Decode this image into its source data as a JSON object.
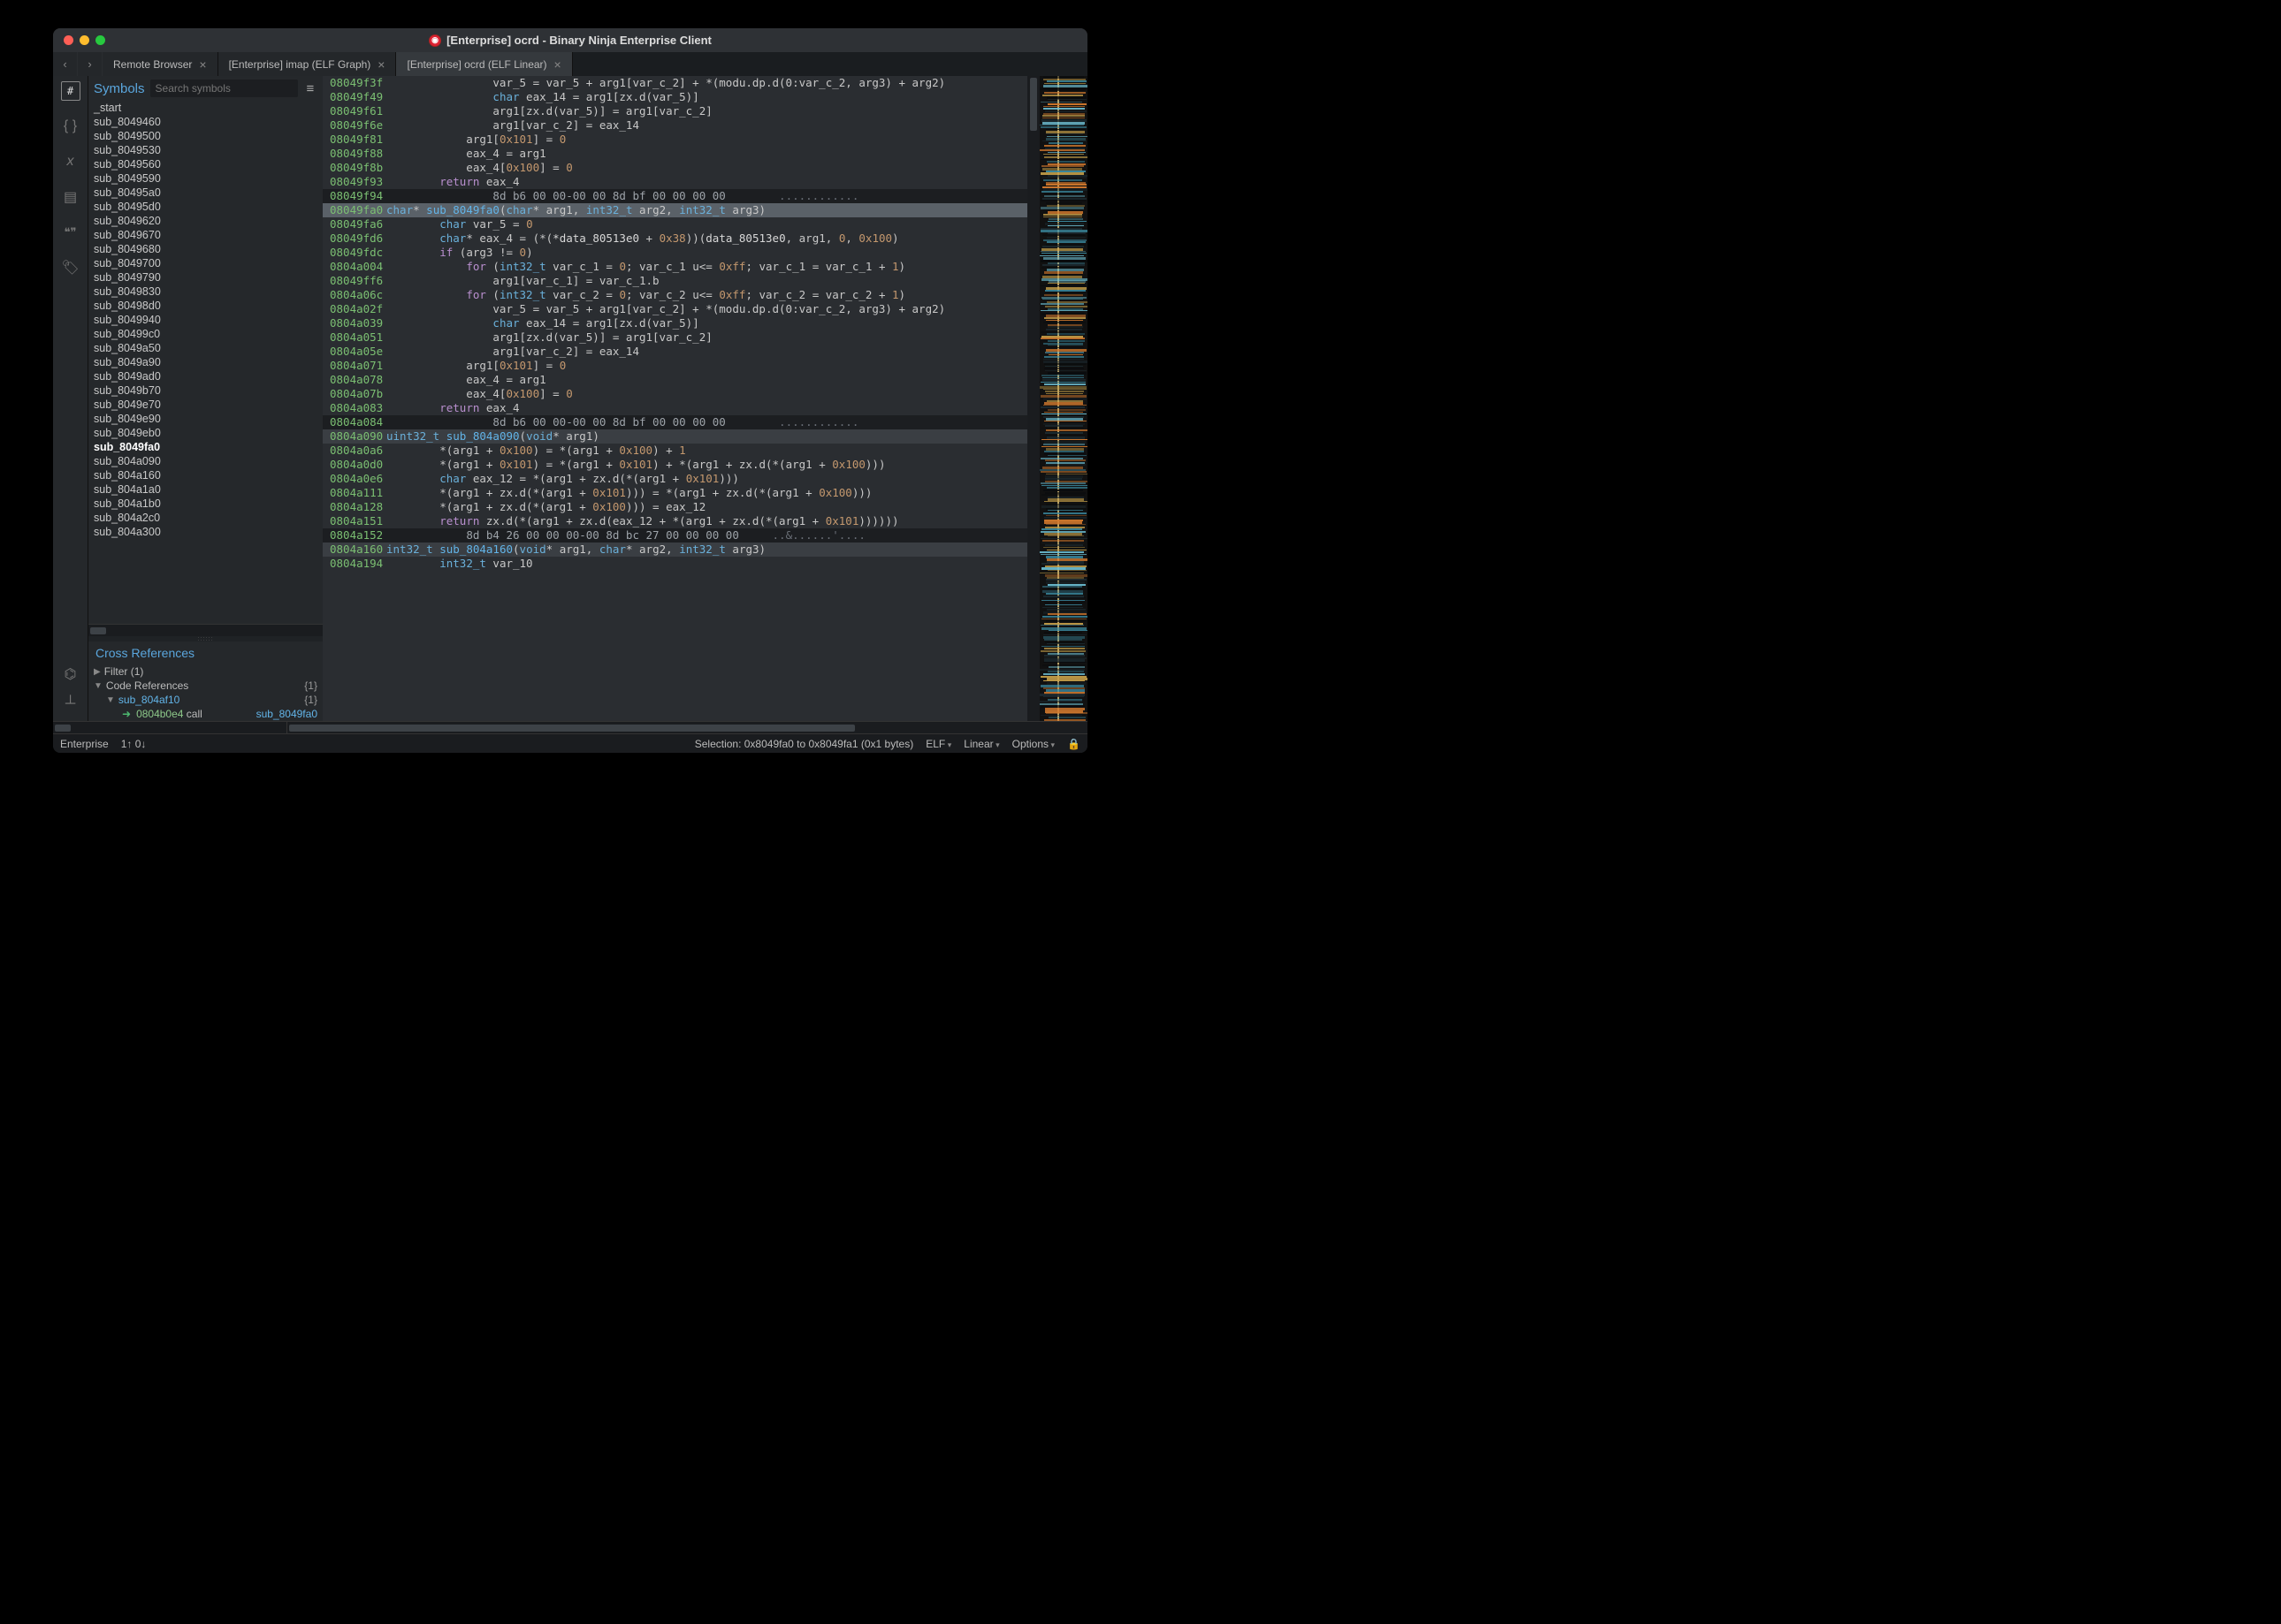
{
  "window_title": "[Enterprise] ocrd - Binary Ninja Enterprise Client",
  "tabs": [
    {
      "label": "Remote Browser",
      "active": false
    },
    {
      "label": "[Enterprise] imap (ELF Graph)",
      "active": false
    },
    {
      "label": "[Enterprise] ocrd (ELF Linear)",
      "active": true
    }
  ],
  "symbols": {
    "title": "Symbols",
    "search_placeholder": "Search symbols",
    "items": [
      "_start",
      "sub_8049460",
      "sub_8049500",
      "sub_8049530",
      "sub_8049560",
      "sub_8049590",
      "sub_80495a0",
      "sub_80495d0",
      "sub_8049620",
      "sub_8049670",
      "sub_8049680",
      "sub_8049700",
      "sub_8049790",
      "sub_8049830",
      "sub_80498d0",
      "sub_8049940",
      "sub_80499c0",
      "sub_8049a50",
      "sub_8049a90",
      "sub_8049ad0",
      "sub_8049b70",
      "sub_8049e70",
      "sub_8049e90",
      "sub_8049eb0",
      "sub_8049fa0",
      "sub_804a090",
      "sub_804a160",
      "sub_804a1a0",
      "sub_804a1b0",
      "sub_804a2c0",
      "sub_804a300"
    ],
    "selected": "sub_8049fa0"
  },
  "xref": {
    "title": "Cross References",
    "filter_label": "Filter (1)",
    "code_refs_label": "Code References",
    "code_refs_count": "{1}",
    "sub_label": "sub_804af10",
    "sub_count": "{1}",
    "call_addr": "0804b0e4",
    "call_kw": "call",
    "call_target": "sub_8049fa0"
  },
  "code": [
    {
      "a": "08049f3f",
      "t": "                var_5 = var_5 + arg1[var_c_2] + *(modu.dp.d(0:var_c_2, arg3) + arg2)",
      "cls": ""
    },
    {
      "a": "08049f49",
      "t": "                <span class='k-ty'>char</span> eax_14 = arg1[zx.d(var_5)]",
      "cls": ""
    },
    {
      "a": "08049f61",
      "t": "                arg1[zx.d(var_5)] = arg1[var_c_2]",
      "cls": ""
    },
    {
      "a": "08049f6e",
      "t": "                arg1[var_c_2] = eax_14",
      "cls": ""
    },
    {
      "a": "08049f81",
      "t": "            arg1[<span class='k-num'>0x101</span>] = <span class='k-num'>0</span>",
      "cls": ""
    },
    {
      "a": "08049f88",
      "t": "            eax_4 = arg1",
      "cls": ""
    },
    {
      "a": "08049f8b",
      "t": "            eax_4[<span class='k-num'>0x100</span>] = <span class='k-num'>0</span>",
      "cls": ""
    },
    {
      "a": "08049f93",
      "t": "        <span class='k-kw'>return</span> eax_4",
      "cls": ""
    },
    {
      "a": "",
      "t": "",
      "cls": ""
    },
    {
      "a": "08049f94",
      "t": "                <span class='k-dim'>8d b6 00 00-00 00 8d bf 00 00 00 00</span>        <span class='k-cm'>............</span>",
      "cls": "bar"
    },
    {
      "a": "",
      "t": "",
      "cls": ""
    },
    {
      "a": "08049fa0",
      "t": "<span class='k-ty'>char</span>* <span class='k-fn'>sub_8049fa0</span>(<span class='k-ty'>char</span>* arg1, <span class='k-ty'>int32_t</span> arg2, <span class='k-ty'>int32_t</span> arg3)",
      "cls": "sel"
    },
    {
      "a": "",
      "t": "",
      "cls": ""
    },
    {
      "a": "08049fa6",
      "t": "        <span class='k-ty'>char</span> var_5 = <span class='k-num'>0</span>",
      "cls": ""
    },
    {
      "a": "08049fd6",
      "t": "        <span class='k-ty'>char</span>* eax_4 = (*(<span class='k-id'>*data_80513e0</span> + <span class='k-num'>0x38</span>))(<span class='k-id'>data_80513e0</span>, arg1, <span class='k-num'>0</span>, <span class='k-num'>0x100</span>)",
      "cls": ""
    },
    {
      "a": "08049fdc",
      "t": "        <span class='k-kw'>if</span> (arg3 != <span class='k-num'>0</span>)",
      "cls": ""
    },
    {
      "a": "0804a004",
      "t": "            <span class='k-kw'>for</span> (<span class='k-ty'>int32_t</span> var_c_1 = <span class='k-num'>0</span>; var_c_1 u<= <span class='k-num'>0xff</span>; var_c_1 = var_c_1 + <span class='k-num'>1</span>)",
      "cls": ""
    },
    {
      "a": "08049ff6",
      "t": "                arg1[var_c_1] = var_c_1.b",
      "cls": ""
    },
    {
      "a": "0804a06c",
      "t": "            <span class='k-kw'>for</span> (<span class='k-ty'>int32_t</span> var_c_2 = <span class='k-num'>0</span>; var_c_2 u<= <span class='k-num'>0xff</span>; var_c_2 = var_c_2 + <span class='k-num'>1</span>)",
      "cls": ""
    },
    {
      "a": "0804a02f",
      "t": "                var_5 = var_5 + arg1[var_c_2] + *(modu.dp.d(0:var_c_2, arg3) + arg2)",
      "cls": ""
    },
    {
      "a": "0804a039",
      "t": "                <span class='k-ty'>char</span> eax_14 = arg1[zx.d(var_5)]",
      "cls": ""
    },
    {
      "a": "0804a051",
      "t": "                arg1[zx.d(var_5)] = arg1[var_c_2]",
      "cls": ""
    },
    {
      "a": "0804a05e",
      "t": "                arg1[var_c_2] = eax_14",
      "cls": ""
    },
    {
      "a": "0804a071",
      "t": "            arg1[<span class='k-num'>0x101</span>] = <span class='k-num'>0</span>",
      "cls": ""
    },
    {
      "a": "0804a078",
      "t": "            eax_4 = arg1",
      "cls": ""
    },
    {
      "a": "0804a07b",
      "t": "            eax_4[<span class='k-num'>0x100</span>] = <span class='k-num'>0</span>",
      "cls": ""
    },
    {
      "a": "0804a083",
      "t": "        <span class='k-kw'>return</span> eax_4",
      "cls": ""
    },
    {
      "a": "",
      "t": "",
      "cls": ""
    },
    {
      "a": "0804a084",
      "t": "                <span class='k-dim'>8d b6 00 00-00 00 8d bf 00 00 00 00</span>        <span class='k-cm'>............</span>",
      "cls": "bar"
    },
    {
      "a": "",
      "t": "",
      "cls": ""
    },
    {
      "a": "0804a090",
      "t": "<span class='k-ty'>uint32_t</span> <span class='k-fn'>sub_804a090</span>(<span class='k-ty'>void</span>* arg1)",
      "cls": "hdr"
    },
    {
      "a": "",
      "t": "",
      "cls": ""
    },
    {
      "a": "0804a0a6",
      "t": "        *(arg1 + <span class='k-num'>0x100</span>) = *(arg1 + <span class='k-num'>0x100</span>) + <span class='k-num'>1</span>",
      "cls": ""
    },
    {
      "a": "0804a0d0",
      "t": "        *(arg1 + <span class='k-num'>0x101</span>) = *(arg1 + <span class='k-num'>0x101</span>) + *(arg1 + zx.d(*(arg1 + <span class='k-num'>0x100</span>)))",
      "cls": ""
    },
    {
      "a": "0804a0e6",
      "t": "        <span class='k-ty'>char</span> eax_12 = *(arg1 + zx.d(*(arg1 + <span class='k-num'>0x101</span>)))",
      "cls": ""
    },
    {
      "a": "0804a111",
      "t": "        *(arg1 + zx.d(*(arg1 + <span class='k-num'>0x101</span>))) = *(arg1 + zx.d(*(arg1 + <span class='k-num'>0x100</span>)))",
      "cls": ""
    },
    {
      "a": "0804a128",
      "t": "        *(arg1 + zx.d(*(arg1 + <span class='k-num'>0x100</span>))) = eax_12",
      "cls": ""
    },
    {
      "a": "0804a151",
      "t": "        <span class='k-kw'>return</span> zx.d(*(arg1 + zx.d(eax_12 + *(arg1 + zx.d(*(arg1 + <span class='k-num'>0x101</span>))))))",
      "cls": ""
    },
    {
      "a": "",
      "t": "",
      "cls": ""
    },
    {
      "a": "0804a152",
      "t": "            <span class='k-dim'>8d b4 26 00 00 00-00 8d bc 27 00 00 00 00</span>     <span class='k-cm'>..&amp;......'....</span>",
      "cls": "bar"
    },
    {
      "a": "",
      "t": "",
      "cls": ""
    },
    {
      "a": "0804a160",
      "t": "<span class='k-ty'>int32_t</span> <span class='k-fn'>sub_804a160</span>(<span class='k-ty'>void</span>* arg1, <span class='k-ty'>char</span>* arg2, <span class='k-ty'>int32_t</span> arg3)",
      "cls": "hdr"
    },
    {
      "a": "",
      "t": "",
      "cls": ""
    },
    {
      "a": "0804a194",
      "t": "        <span class='k-ty'>int32_t</span> var_10",
      "cls": ""
    }
  ],
  "status": {
    "enterprise": "Enterprise",
    "counter": "1↑ 0↓",
    "selection": "Selection: 0x8049fa0 to 0x8049fa1 (0x1 bytes)",
    "elf": "ELF",
    "view": "Linear",
    "options": "Options"
  }
}
